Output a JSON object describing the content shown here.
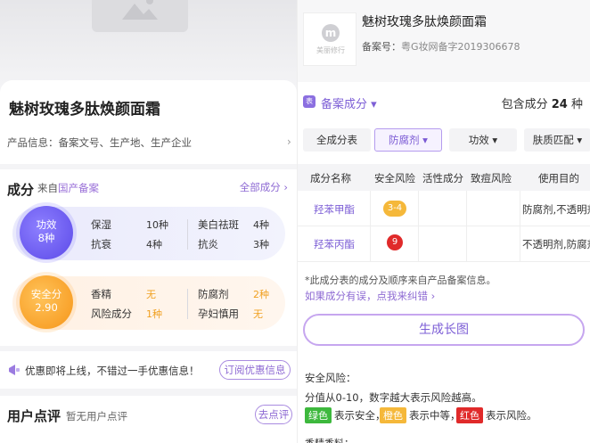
{
  "left": {
    "product_title": "魅树玫瑰多肽焕颜面霜",
    "product_info": "产品信息：备案文号、生产地、生产企业",
    "ingredients": {
      "title": "成分",
      "source_prefix": "来自",
      "source_link": "国产备案",
      "all_link": "全部成分",
      "efficacy": {
        "circle_label": "功效",
        "circle_value": "8种",
        "items": [
          {
            "name": "保湿",
            "count": "10种"
          },
          {
            "name": "美白祛斑",
            "count": "4种"
          },
          {
            "name": "抗衰",
            "count": "4种"
          },
          {
            "name": "抗炎",
            "count": "3种"
          }
        ]
      },
      "safety": {
        "circle_label": "安全分",
        "circle_value": "2.90",
        "items": [
          {
            "name": "香精",
            "value": "无"
          },
          {
            "name": "防腐剂",
            "value": "2种"
          },
          {
            "name": "风险成分",
            "value": "1种"
          },
          {
            "name": "孕妇慎用",
            "value": "无"
          }
        ]
      }
    },
    "promo": {
      "text": "优惠即将上线，不错过一手优惠信息！",
      "button": "订阅优惠信息"
    },
    "reviews": {
      "title": "用户点评",
      "subtitle": "暂无用户点评",
      "button": "去点评"
    }
  },
  "right": {
    "logo_text": "美丽修行",
    "logo_letter": "m",
    "product_name": "魅树玫瑰多肽焕颜面霜",
    "registration_label": "备案号：",
    "registration_value": "粤G妆网备字2019306678",
    "section_tag": "表",
    "section_title": "备案成分",
    "section_arrow": "▾",
    "count_prefix": "包含成分",
    "count_value": "24",
    "count_suffix": "种",
    "filters": [
      "全成分表",
      "防腐剂 ▾",
      "功效 ▾",
      "肤质匹配 ▾"
    ],
    "table": {
      "headers": [
        "成分名称",
        "安全风险",
        "活性成分",
        "致痘风险",
        "使用目的"
      ],
      "rows": [
        {
          "name": "羟苯甲酯",
          "risk": "3-4",
          "purpose": "防腐剂,不透明剂"
        },
        {
          "name": "羟苯丙酯",
          "risk": "9",
          "purpose": "不透明剂,防腐剂"
        }
      ]
    },
    "note": "*此成分表的成分及顺序来自产品备案信息。",
    "fix_link": "如果成分有误，点我来纠错",
    "generate_button": "生成长图",
    "risk_title": "安全风险：",
    "risk_desc": "分值从0-10，数字越大表示风险越高。",
    "legend": [
      {
        "label": "绿色",
        "text": "表示安全，",
        "color": "#3db83d"
      },
      {
        "label": "橙色",
        "text": "表示中等，",
        "color": "#f5b83a"
      },
      {
        "label": "红色",
        "text": "表示风险。",
        "color": "#e02a2a"
      }
    ],
    "more_title": "香精香料："
  }
}
